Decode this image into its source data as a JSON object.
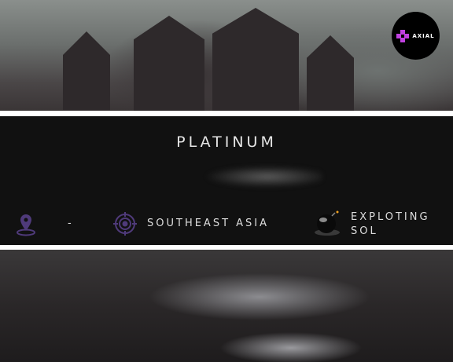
{
  "brand": {
    "logo_text": "AXIAL",
    "accent": "#c040e0"
  },
  "card": {
    "rank": "PLATINUM",
    "location": "-",
    "region": "SOUTHEAST ASIA",
    "role_line1": "EXPLOTING",
    "role_line2": "SOL",
    "icon_color": "#4f3a7a"
  }
}
